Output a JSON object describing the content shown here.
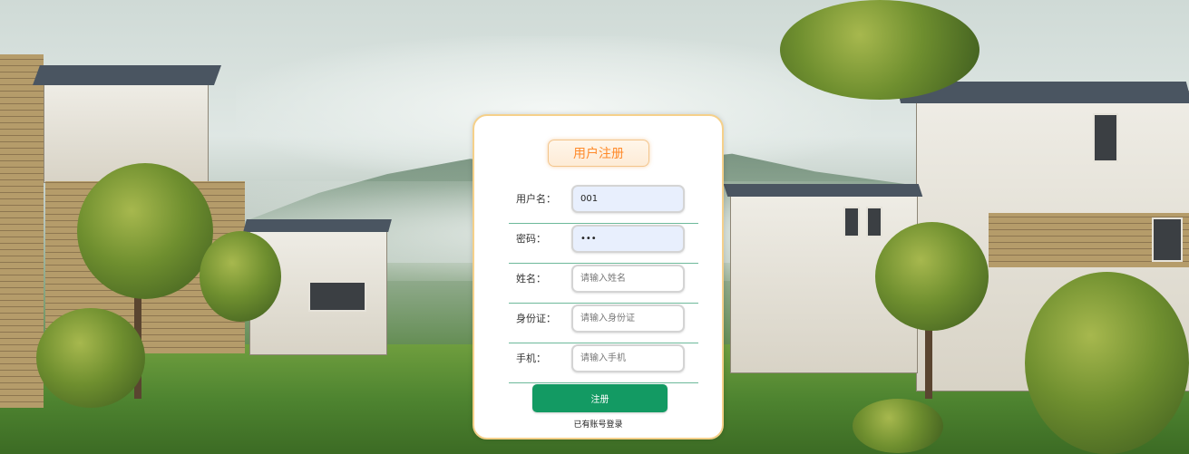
{
  "register": {
    "title": "用户注册",
    "fields": [
      {
        "label": "用户名：",
        "value": "001",
        "placeholder": ""
      },
      {
        "label": "密码：",
        "value": "•••",
        "placeholder": ""
      },
      {
        "label": "姓名：",
        "value": "",
        "placeholder": "请输入姓名"
      },
      {
        "label": "身份证：",
        "value": "",
        "placeholder": "请输入身份证"
      },
      {
        "label": "手机：",
        "value": "",
        "placeholder": "请输入手机"
      }
    ],
    "submit_label": "注册",
    "login_link": "已有账号登录"
  },
  "colors": {
    "accent": "#139a63",
    "title_text": "#ff8a2a",
    "card_border": "#f5d08a",
    "row_divider": "#6db99a",
    "filled_input_bg": "#e8effd"
  },
  "background": {
    "icons": [
      "villa-scene-background"
    ]
  }
}
